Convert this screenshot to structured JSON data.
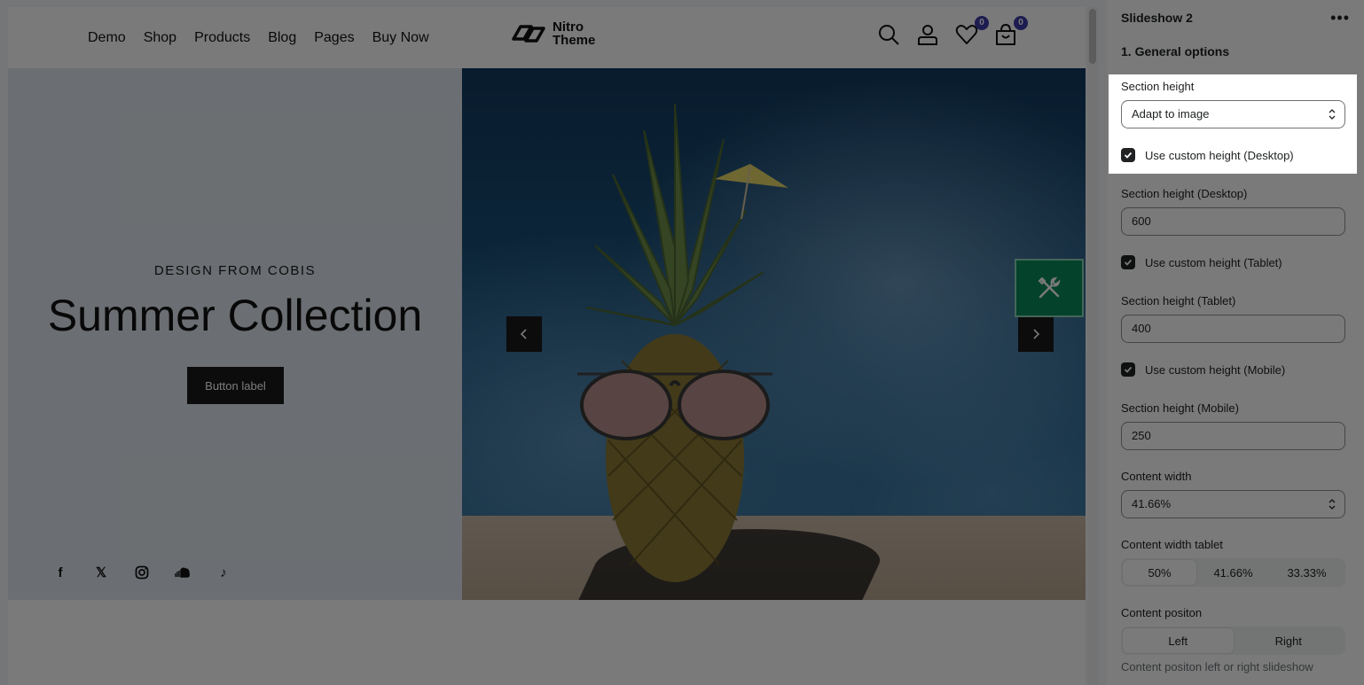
{
  "site": {
    "nav": [
      "Demo",
      "Shop",
      "Products",
      "Blog",
      "Pages",
      "Buy Now"
    ],
    "logo_line1": "Nitro",
    "logo_line2": "Theme",
    "wishlist_count": "0",
    "cart_count": "0"
  },
  "hero": {
    "eyebrow": "DESIGN FROM COBIS",
    "headline": "Summer Collection",
    "button_label": "Button label",
    "socials": [
      "facebook-icon",
      "x-icon",
      "instagram-icon",
      "soundcloud-icon",
      "tiktok-icon"
    ]
  },
  "panel": {
    "title": "Slideshow 2",
    "group": "1. General options",
    "section_height_label": "Section height",
    "section_height_value": "Adapt to image",
    "custom_desktop_label": "Use custom height (Desktop)",
    "height_desktop_label": "Section height (Desktop)",
    "height_desktop_value": "600",
    "custom_tablet_label": "Use custom height (Tablet)",
    "height_tablet_label": "Section height (Tablet)",
    "height_tablet_value": "400",
    "custom_mobile_label": "Use custom height (Mobile)",
    "height_mobile_label": "Section height (Mobile)",
    "height_mobile_value": "250",
    "content_width_label": "Content width",
    "content_width_value": "41.66%",
    "content_width_tablet_label": "Content width tablet",
    "content_width_tablet_options": [
      "50%",
      "41.66%",
      "33.33%"
    ],
    "content_position_label": "Content positon",
    "content_position_options": [
      "Left",
      "Right"
    ],
    "content_position_hint": "Content positon left or right slideshow"
  },
  "colors": {
    "accent_badge": "#3c3ca8",
    "tool_button": "#0b8a5d",
    "hero_left_bg": "#dfe7ef"
  }
}
